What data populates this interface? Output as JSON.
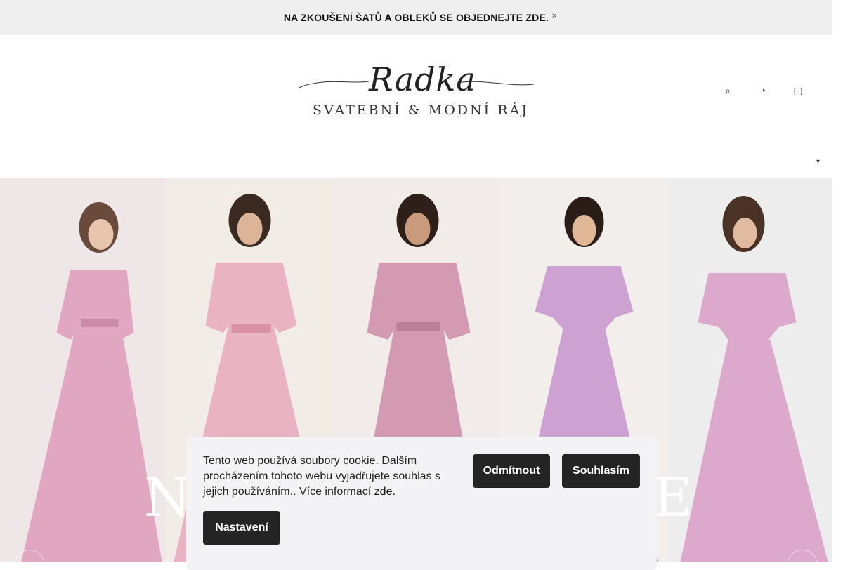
{
  "announcement": {
    "text": "NA ZKOUŠENÍ ŠATŮ A OBLEKŮ SE OBJEDNEJTE ZDE.",
    "close_icon": "close-icon"
  },
  "logo": {
    "script": "Radka",
    "subtitle": "SVATEBNÍ & MODNÍ RÁJ"
  },
  "header_icons": [
    "search-icon",
    "user-icon",
    "cart-icon"
  ],
  "menu_icon": "chevron-down-icon",
  "hero": {
    "prev_icon": "chevron-left-icon",
    "next_icon": "chevron-right-icon",
    "dress_colors": [
      "#e2a7c0",
      "#eab3c3",
      "#d49ab1",
      "#cda2d3",
      "#dca9cd"
    ],
    "background_colors": [
      "#efe7e7",
      "#f2ece6",
      "#f1ece9",
      "#f2eeec",
      "#ededed"
    ],
    "overlay_letters": {
      "left": "N",
      "right": "E"
    }
  },
  "cookie_bar": {
    "text_before_link": "Tento web používá soubory cookie. Dalším procházením tohoto webu vyjadřujete souhlas s jejich používáním.. Více informací",
    "link_text": "zde",
    "text_after_link": ".",
    "reject_label": "Odmítnout",
    "accept_label": "Souhlasím",
    "settings_label": "Nastavení"
  }
}
